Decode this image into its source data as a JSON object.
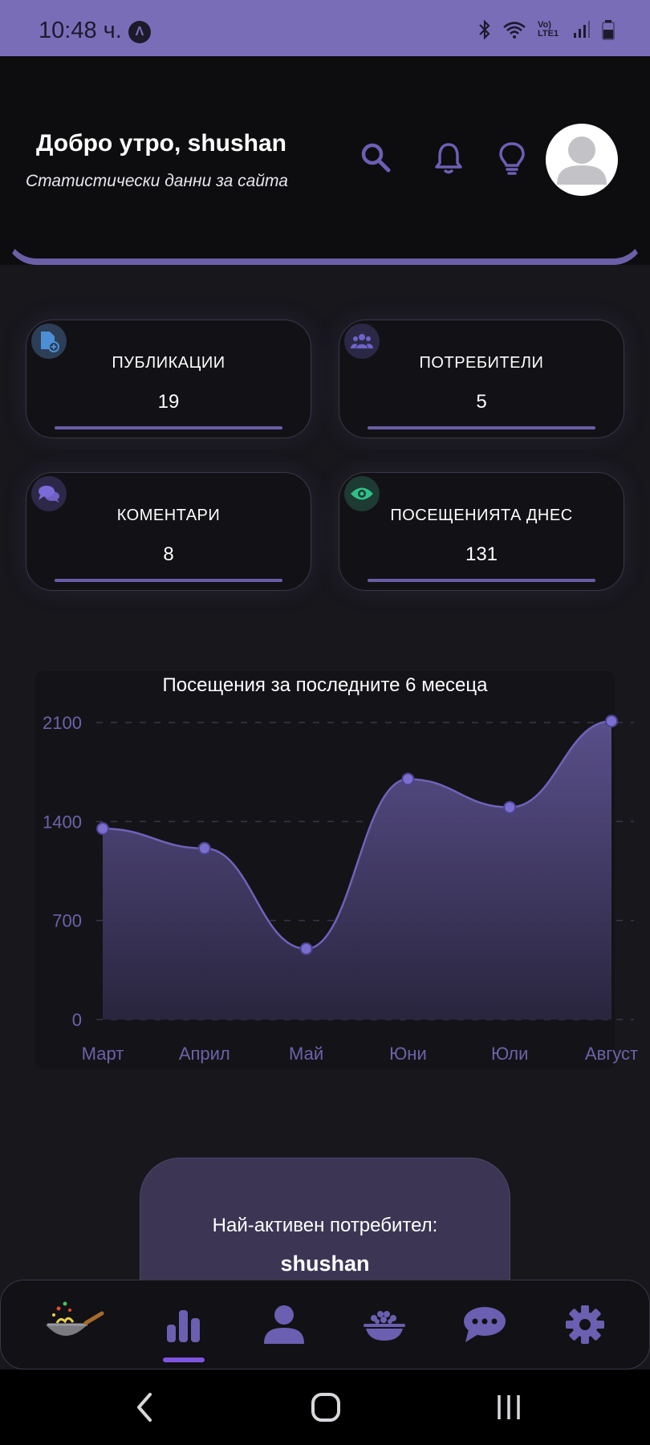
{
  "status_bar": {
    "time": "10:48 ч.",
    "app_icon": "Λ",
    "network": "Vo) LTE1",
    "accent": "#7a6db8"
  },
  "header": {
    "greeting": "Добро утро, shushan",
    "subtitle": "Статистически данни за сайта",
    "icons": [
      "search-icon",
      "bell-icon",
      "lightbulb-icon",
      "avatar"
    ]
  },
  "stats": [
    {
      "label": "ПУБЛИКАЦИИ",
      "value": "19",
      "icon": "file-add-icon",
      "icon_color": "#4d8fd6",
      "icon_bg": "#2c3f57"
    },
    {
      "label": "ПОТРЕБИТЕЛИ",
      "value": "5",
      "icon": "users-icon",
      "icon_color": "#6f63c9",
      "icon_bg": "#2b2845"
    },
    {
      "label": "КОМЕНТАРИ",
      "value": "8",
      "icon": "comments-icon",
      "icon_color": "#7a6bd8",
      "icon_bg": "#2d2847"
    },
    {
      "label": "ПОСЕЩЕНИЯТА ДНЕС",
      "value": "131",
      "icon": "eye-icon",
      "icon_color": "#2fbf87",
      "icon_bg": "#1d3a33"
    }
  ],
  "chart_data": {
    "type": "area",
    "title": "Посещения за последните 6 месеца",
    "categories": [
      "Март",
      "Април",
      "Май",
      "Юни",
      "Юли",
      "Август"
    ],
    "values": [
      1350,
      1210,
      500,
      1700,
      1500,
      2110
    ],
    "yticks": [
      "0",
      "700",
      "1400",
      "2100"
    ],
    "ylim": [
      0,
      2100
    ],
    "grid": "dashed horizontal",
    "line_color": "#6e63b8",
    "point_color": "#7a6fd0"
  },
  "most_active": {
    "label": "Най-активен потребител:",
    "name": "shushan"
  },
  "tab_bar": {
    "items": [
      "wok-icon",
      "bar-chart-icon",
      "user-icon",
      "food-bowl-icon",
      "chat-icon",
      "gear-icon"
    ],
    "active": "bar-chart-icon",
    "active_color": "#7d54e0",
    "icon_color": "#6a5fb0"
  },
  "system_nav": [
    "back-icon",
    "home-icon",
    "recents-icon"
  ]
}
